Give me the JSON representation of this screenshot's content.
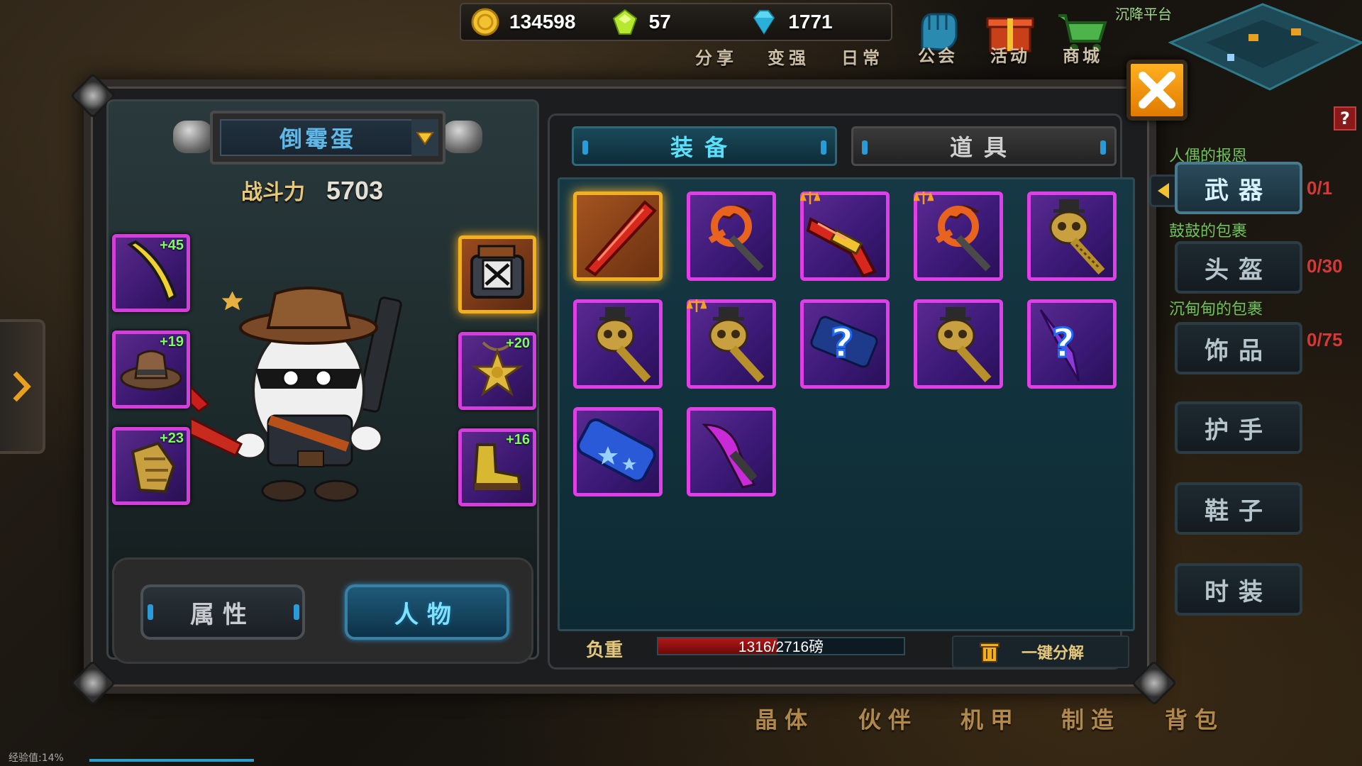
{
  "resources": [
    {
      "name": "gold",
      "icon": "gold-coin-icon",
      "value": "134598",
      "color": "#f2c230"
    },
    {
      "name": "gem",
      "icon": "green-gem-icon",
      "value": "57",
      "color": "#b6e830"
    },
    {
      "name": "diamond",
      "icon": "blue-diamond-icon",
      "value": "1771",
      "color": "#5ad8f0"
    }
  ],
  "top_links": {
    "share": "分享",
    "strengthen": "变强",
    "daily": "日常"
  },
  "top_icons": [
    {
      "name": "guild",
      "label": "公会",
      "icon": "fist-icon"
    },
    {
      "name": "event",
      "label": "活动",
      "icon": "gift-icon"
    },
    {
      "name": "shop",
      "label": "商城",
      "icon": "cart-icon"
    }
  ],
  "minimap": {
    "title": "沉降平台"
  },
  "character": {
    "name": "倒霉蛋",
    "power_label": "战斗力",
    "power_value": "5703"
  },
  "equipped": {
    "weapon": {
      "plus": "+45",
      "icon": "golden-blade-icon"
    },
    "helmet": {
      "plus": "+19",
      "icon": "cowboy-hat-icon"
    },
    "gloves": {
      "plus": "+23",
      "icon": "gauntlet-icon"
    },
    "armor": {
      "plus": "",
      "icon": "armor-chest-icon"
    },
    "accessory": {
      "plus": "+20",
      "icon": "sheriff-badge-icon"
    },
    "shoes": {
      "plus": "+16",
      "icon": "boots-icon"
    }
  },
  "char_tabs": {
    "attributes": "属性",
    "character": "人物"
  },
  "inventory": {
    "tabs": {
      "equipment": "装备",
      "items": "道具"
    },
    "items": [
      {
        "icon": "red-sword-icon",
        "rarity": "gold",
        "tag": ""
      },
      {
        "icon": "orange-scythe-icon",
        "rarity": "purple",
        "tag": ""
      },
      {
        "icon": "red-gun-icon",
        "rarity": "purple",
        "tag": "scale"
      },
      {
        "icon": "orange-scythe-icon",
        "rarity": "purple",
        "tag": "scale"
      },
      {
        "icon": "skull-mace-icon",
        "rarity": "purple",
        "tag": ""
      },
      {
        "icon": "skull-mace-icon",
        "rarity": "purple",
        "tag": ""
      },
      {
        "icon": "skull-mace-icon",
        "rarity": "purple",
        "tag": "scale"
      },
      {
        "icon": "mystery-cannon-icon",
        "rarity": "purple",
        "tag": ""
      },
      {
        "icon": "skull-mace-icon",
        "rarity": "purple",
        "tag": ""
      },
      {
        "icon": "mystery-dagger-icon",
        "rarity": "purple",
        "tag": ""
      },
      {
        "icon": "star-cannon-icon",
        "rarity": "purple",
        "tag": ""
      },
      {
        "icon": "purple-claw-icon",
        "rarity": "purple",
        "tag": ""
      }
    ],
    "weight_label": "负重",
    "weight_text": "1316/2716磅",
    "weight_fraction": 0.4845,
    "decompose_label": "一键分解"
  },
  "categories": [
    {
      "label": "武器",
      "count": "0/1",
      "note": "人偶的报恩"
    },
    {
      "label": "头盔",
      "count": "0/30",
      "note": "鼓鼓的包裹"
    },
    {
      "label": "饰品",
      "count": "0/75",
      "note": "沉甸甸的包裹"
    },
    {
      "label": "护手",
      "count": "",
      "note": ""
    },
    {
      "label": "鞋子",
      "count": "",
      "note": ""
    },
    {
      "label": "时装",
      "count": "",
      "note": ""
    }
  ],
  "help_label": "?",
  "bottom_nav": [
    {
      "label": "晶体"
    },
    {
      "label": "伙伴"
    },
    {
      "label": "机甲"
    },
    {
      "label": "制造"
    },
    {
      "label": "背包"
    }
  ],
  "exp_label": "经验值:14%"
}
